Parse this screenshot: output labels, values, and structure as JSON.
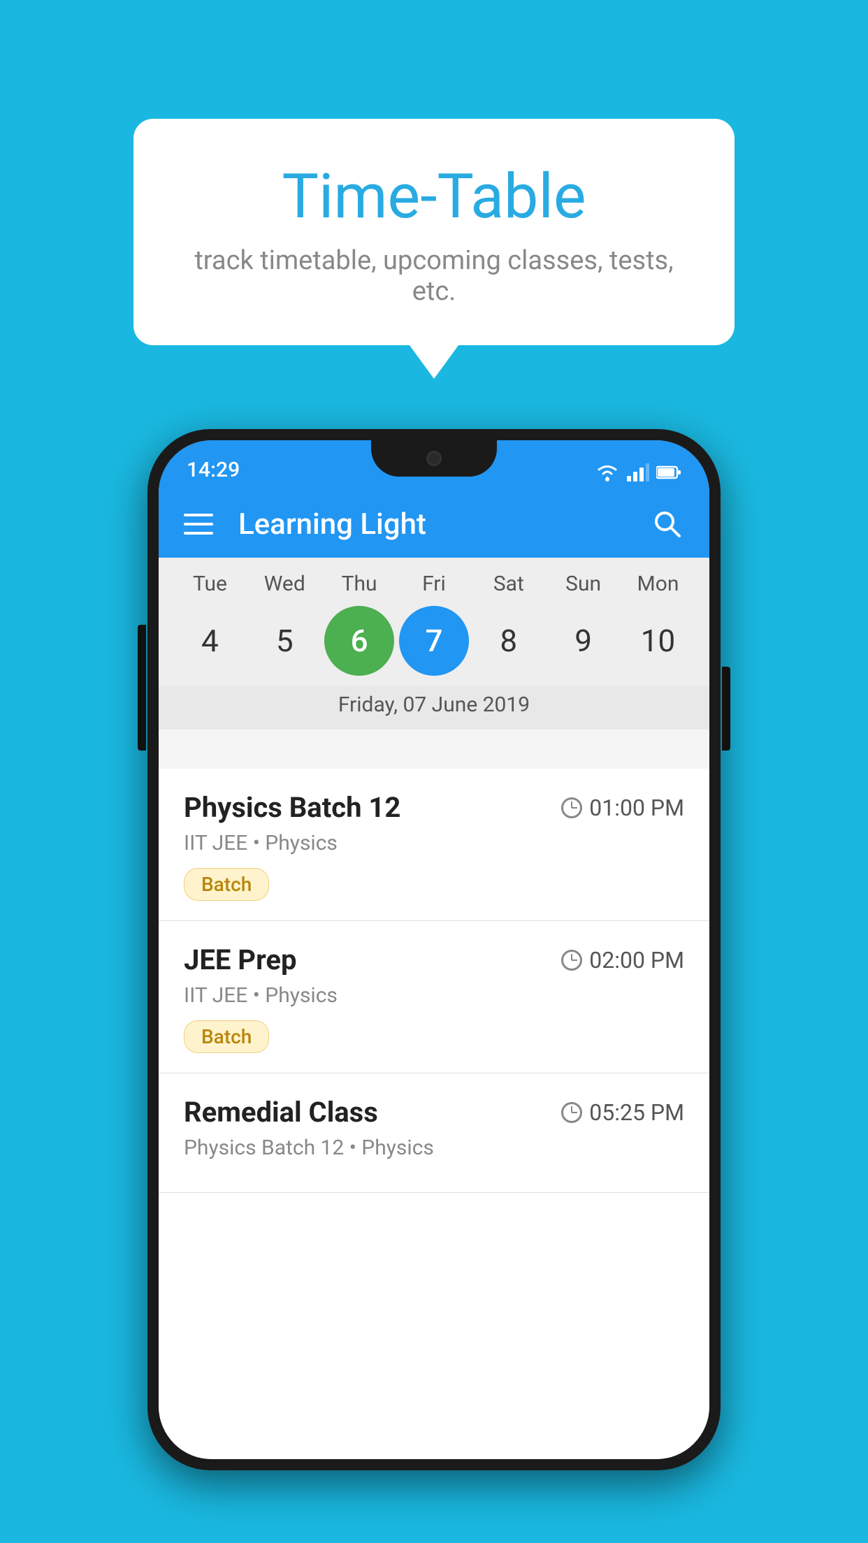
{
  "background_color": "#1ab8e0",
  "tooltip": {
    "title": "Time-Table",
    "subtitle": "track timetable, upcoming classes, tests, etc."
  },
  "phone": {
    "status_bar": {
      "time": "14:29"
    },
    "app_bar": {
      "title": "Learning Light",
      "menu_icon_label": "menu",
      "search_icon_label": "search"
    },
    "calendar": {
      "days": [
        {
          "label": "Tue",
          "number": "4"
        },
        {
          "label": "Wed",
          "number": "5"
        },
        {
          "label": "Thu",
          "number": "6",
          "state": "today"
        },
        {
          "label": "Fri",
          "number": "7",
          "state": "selected"
        },
        {
          "label": "Sat",
          "number": "8"
        },
        {
          "label": "Sun",
          "number": "9"
        },
        {
          "label": "Mon",
          "number": "10"
        }
      ],
      "selected_date_label": "Friday, 07 June 2019"
    },
    "schedule": [
      {
        "title": "Physics Batch 12",
        "time": "01:00 PM",
        "subtitle": "IIT JEE • Physics",
        "badge": "Batch"
      },
      {
        "title": "JEE Prep",
        "time": "02:00 PM",
        "subtitle": "IIT JEE • Physics",
        "badge": "Batch"
      },
      {
        "title": "Remedial Class",
        "time": "05:25 PM",
        "subtitle": "Physics Batch 12 • Physics",
        "badge": ""
      }
    ]
  }
}
